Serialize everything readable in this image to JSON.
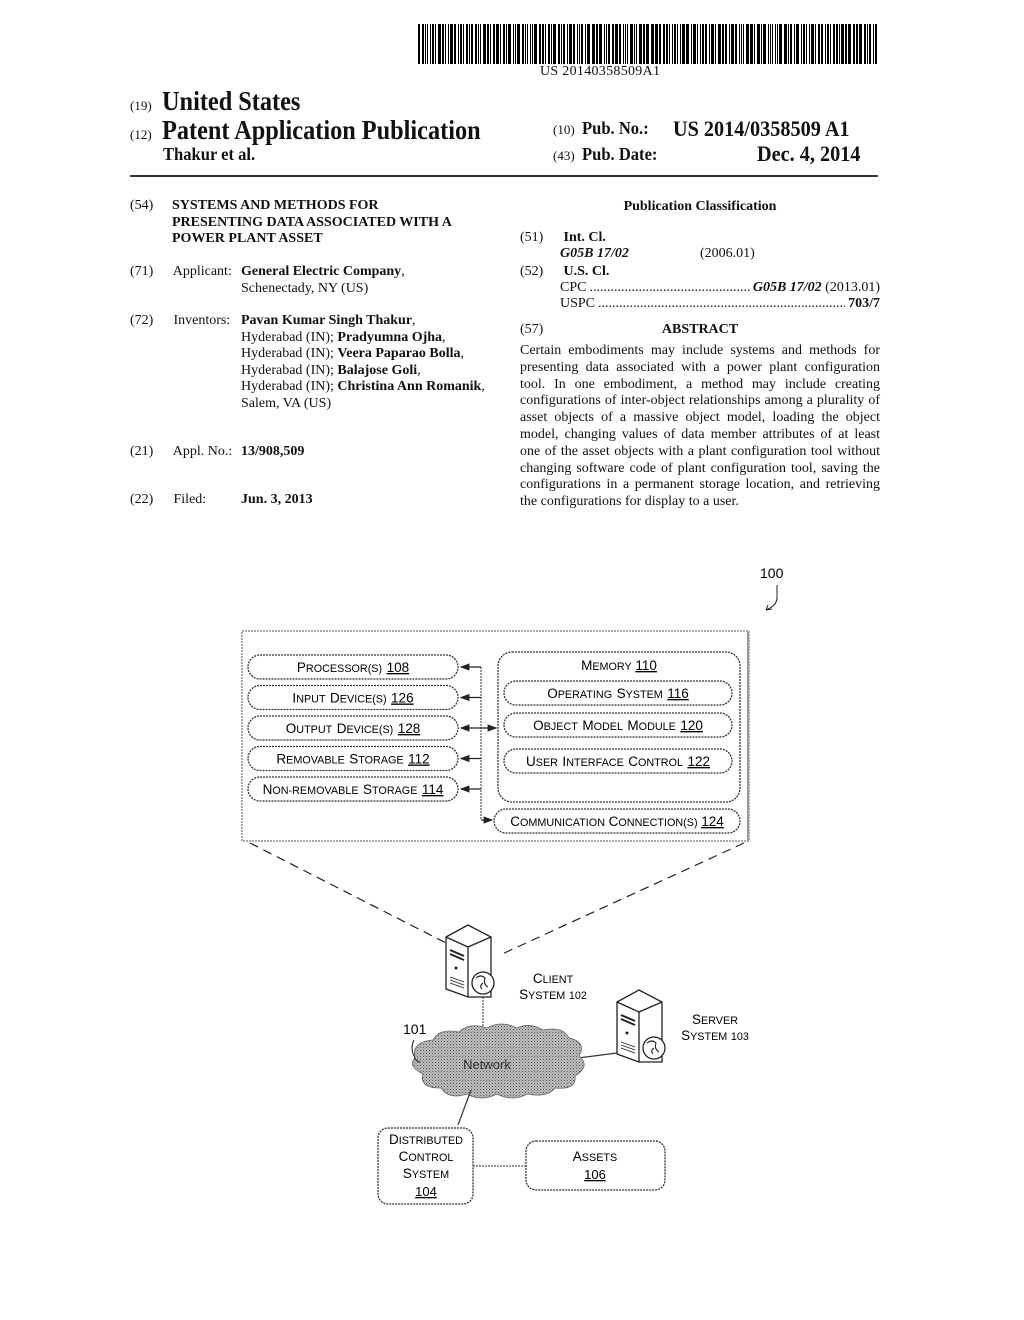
{
  "header": {
    "barcode_text": "US 20140358509A1",
    "country_code": "(19)",
    "country": "United States",
    "pub_type_code": "(12)",
    "pub_type": "Patent Application Publication",
    "authors": "Thakur et al.",
    "pub_no_code": "(10)",
    "pub_no_label": "Pub. No.:",
    "pub_no": "US 2014/0358509 A1",
    "pub_date_code": "(43)",
    "pub_date_label": "Pub. Date:",
    "pub_date": "Dec. 4, 2014"
  },
  "left": {
    "title_code": "(54)",
    "title_lines": [
      "SYSTEMS AND METHODS FOR",
      "PRESENTING DATA ASSOCIATED WITH A",
      "POWER PLANT ASSET"
    ],
    "applicant_code": "(71)",
    "applicant_label": "Applicant:",
    "applicant_name": "General Electric Company",
    "applicant_location": "Schenectady, NY (US)",
    "inventors_code": "(72)",
    "inventors_label": "Inventors:",
    "inventors": [
      {
        "name": "Pavan Kumar Singh Thakur",
        "location": "Hyderabad (IN)"
      },
      {
        "name": "Pradyumna Ojha",
        "location": "Hyderabad (IN)"
      },
      {
        "name": "Veera Paparao Bolla",
        "location": "Hyderabad (IN)"
      },
      {
        "name": "Balajose Goli",
        "location": "Hyderabad (IN)"
      },
      {
        "name": "Christina Ann Romanik",
        "location": "Salem, VA (US)"
      }
    ],
    "appl_code": "(21)",
    "appl_label": "Appl. No.:",
    "appl_no": "13/908,509",
    "filed_code": "(22)",
    "filed_label": "Filed:",
    "filed_date": "Jun. 3, 2013"
  },
  "right": {
    "classification_heading": "Publication Classification",
    "intcl_code": "(51)",
    "intcl_label": "Int. Cl.",
    "intcl_value": "G05B 17/02",
    "intcl_version": "(2006.01)",
    "uscl_code": "(52)",
    "uscl_label": "U.S. Cl.",
    "cpc_label": "CPC",
    "cpc_value": "G05B 17/02",
    "cpc_version": "(2013.01)",
    "uspc_label": "USPC",
    "uspc_value": "703/7",
    "abstract_code": "(57)",
    "abstract_heading": "ABSTRACT",
    "abstract_text": "Certain embodiments may include systems and methods for presenting data associated with a power plant configuration tool. In one embodiment, a method may include creating configurations of inter-object relationships among a plurality of asset objects of a massive object model, loading the object model, changing values of data member attributes of at least one of the asset objects with a plant configuration tool without changing software code of plant configuration tool, saving the configurations in a permanent storage location, and retrieving the configurations for display to a user."
  },
  "figure": {
    "ref_main": "100",
    "left_boxes": [
      {
        "label": "Processor(s)",
        "ref": "108"
      },
      {
        "label": "Input Device(s)",
        "ref": "126"
      },
      {
        "label": "Output Device(s)",
        "ref": "128"
      },
      {
        "label": "Removable Storage",
        "ref": "112"
      },
      {
        "label": "Non-removable Storage",
        "ref": "114"
      }
    ],
    "memory": {
      "label": "Memory",
      "ref": "110"
    },
    "memory_items": [
      {
        "label": "Operating System",
        "ref": "116"
      },
      {
        "label": "Object Model module",
        "ref": "120"
      },
      {
        "label": "User Interface Control",
        "ref": "122"
      }
    ],
    "comm": {
      "label": "Communication Connection(s)",
      "ref": "124"
    },
    "client_label_1": "Client",
    "client_label_2": "system 102",
    "server_label_1": "Server",
    "server_label_2": "system 103",
    "network_ref": "101",
    "network_label": "Network",
    "dcs_lines": [
      "Distributed",
      "Control",
      "System"
    ],
    "dcs_ref": "104",
    "assets_label": "Assets",
    "assets_ref": "106"
  }
}
